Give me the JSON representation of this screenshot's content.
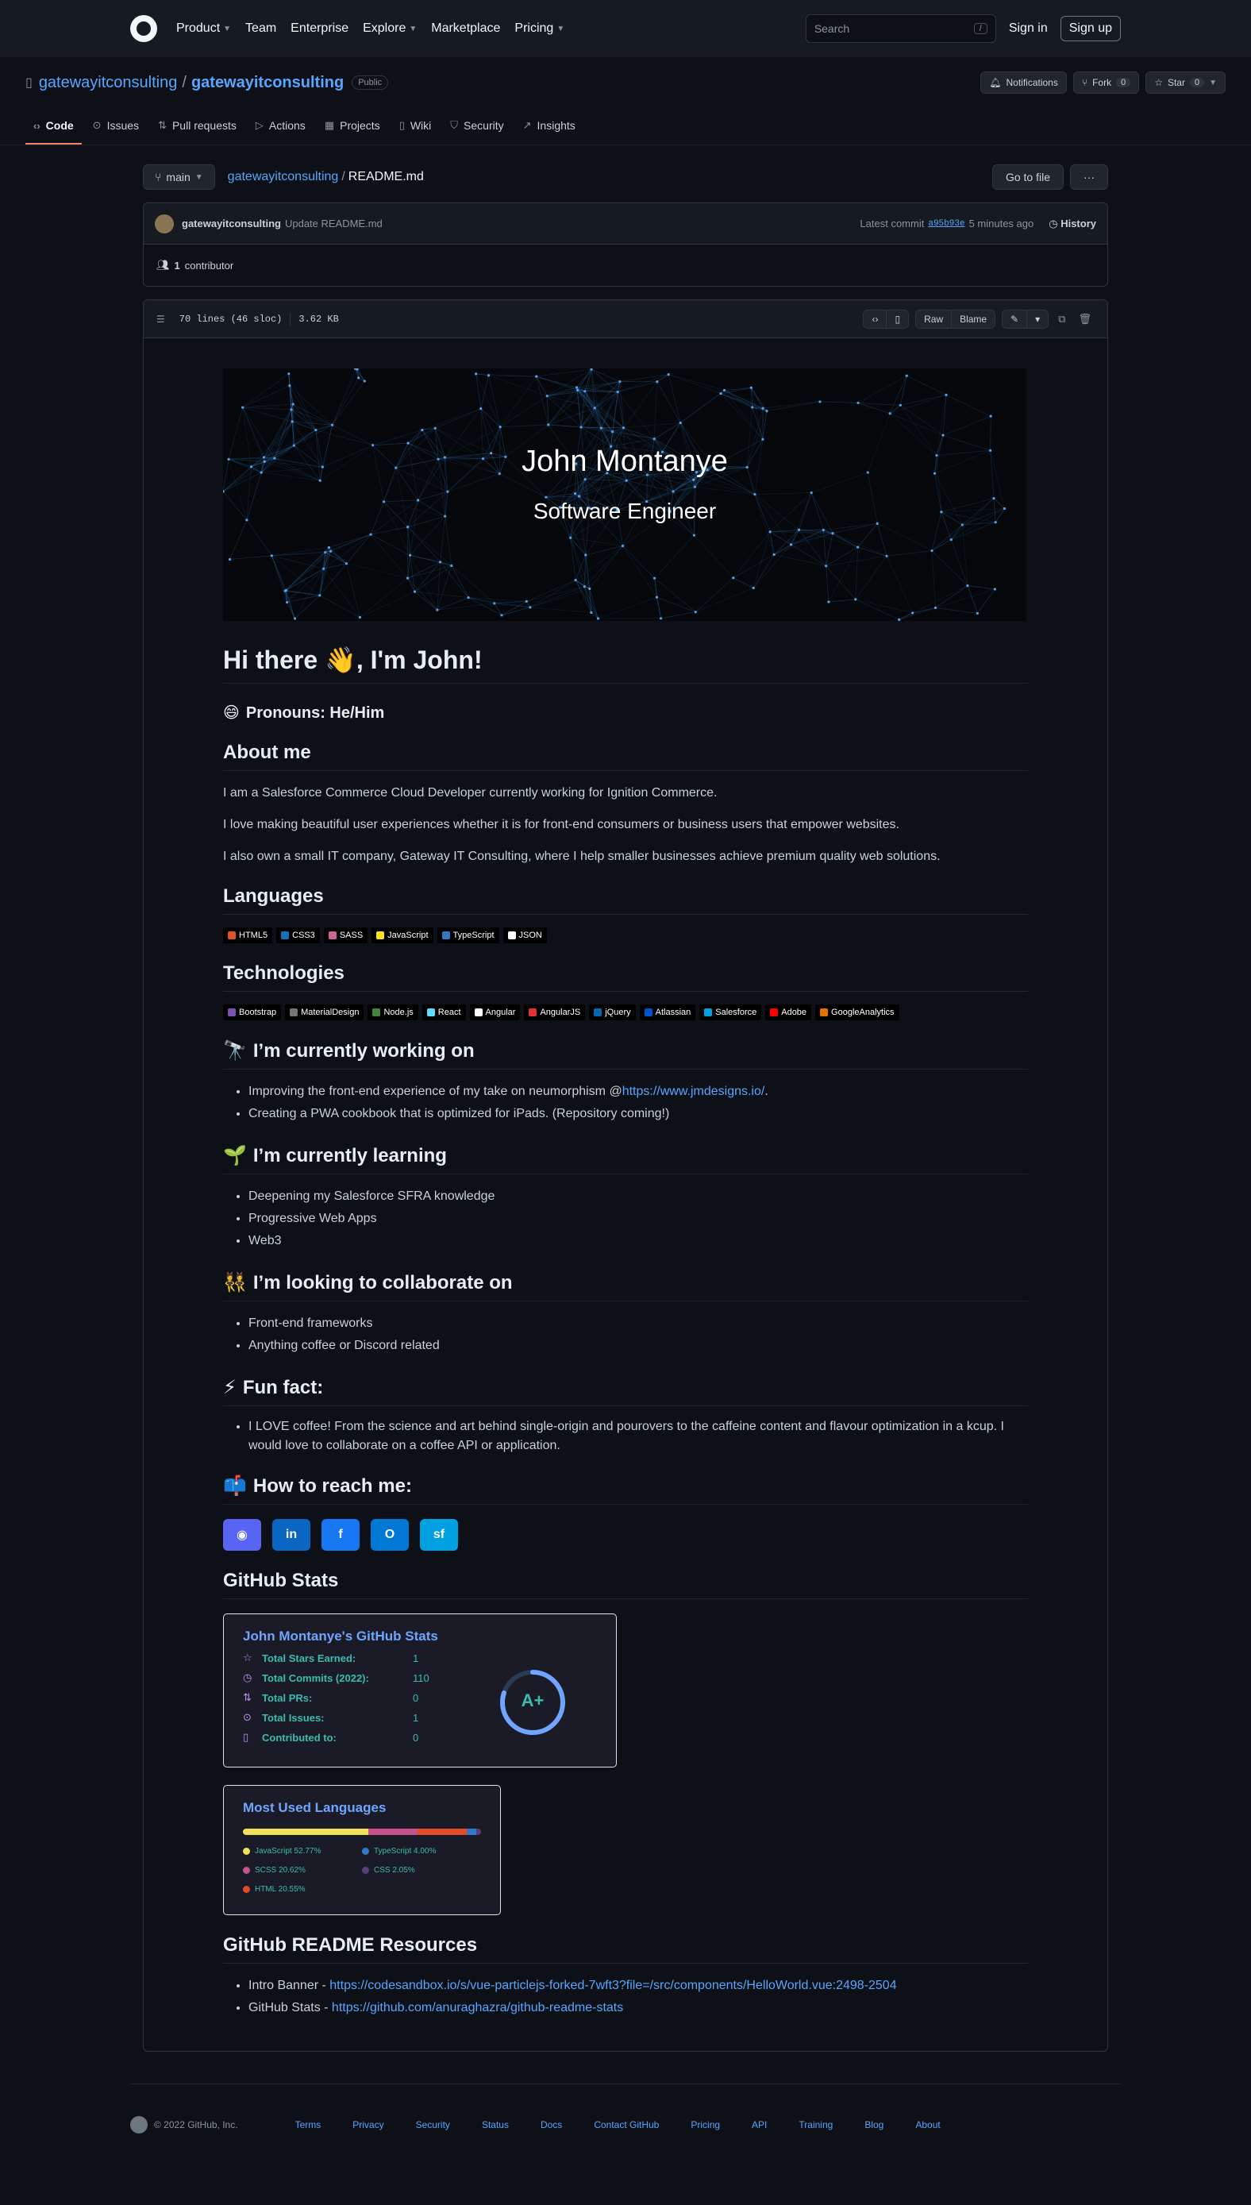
{
  "topnav": {
    "menu": [
      "Product",
      "Team",
      "Enterprise",
      "Explore",
      "Marketplace",
      "Pricing"
    ],
    "menu_dropdown": [
      true,
      false,
      false,
      true,
      false,
      true
    ],
    "search_placeholder": "Search",
    "search_key": "/",
    "signin": "Sign in",
    "signup": "Sign up"
  },
  "repo": {
    "owner": "gatewayitconsulting",
    "name": "gatewayitconsulting",
    "visibility": "Public",
    "notifications": "Notifications",
    "fork_label": "Fork",
    "fork_count": "0",
    "star_label": "Star",
    "star_count": "0"
  },
  "tabs": [
    {
      "label": "Code",
      "icon": "code-icon",
      "glyph": "‹›",
      "active": true
    },
    {
      "label": "Issues",
      "icon": "issue-icon",
      "glyph": "⊙"
    },
    {
      "label": "Pull requests",
      "icon": "pull-request-icon",
      "glyph": "⇅"
    },
    {
      "label": "Actions",
      "icon": "play-icon",
      "glyph": "▷"
    },
    {
      "label": "Projects",
      "icon": "table-icon",
      "glyph": "▦"
    },
    {
      "label": "Wiki",
      "icon": "book-icon",
      "glyph": "▯"
    },
    {
      "label": "Security",
      "icon": "shield-icon",
      "glyph": "⛉"
    },
    {
      "label": "Insights",
      "icon": "graph-icon",
      "glyph": "↗"
    }
  ],
  "filebar": {
    "branch": "main",
    "crumb_repo": "gatewayitconsulting",
    "crumb_file": "README.md",
    "goto": "Go to file",
    "more": "···"
  },
  "commit": {
    "author": "gatewayitconsulting",
    "message": "Update README.md",
    "latest": "Latest commit",
    "sha": "a95b93e",
    "time": "5 minutes ago",
    "history": "History",
    "contributors_count": "1",
    "contributors_label": "contributor"
  },
  "file": {
    "lines": "70 lines (46 sloc)",
    "size": "3.62 KB",
    "raw": "Raw",
    "blame": "Blame"
  },
  "readme": {
    "banner_name": "John Montanye",
    "banner_role": "Software Engineer",
    "greeting_a": "Hi there",
    "greeting_emoji": "👋",
    "greeting_b": ", I'm John!",
    "pronouns_emoji": "😄",
    "pronouns": "Pronouns: He/Him",
    "about_heading": "About me",
    "about": [
      "I am a Salesforce Commerce Cloud Developer currently working for Ignition Commerce.",
      "I love making beautiful user experiences whether it is for front-end consumers or business users that empower websites.",
      "I also own a small IT company, Gateway IT Consulting, where I help smaller businesses achieve premium quality web solutions."
    ],
    "languages_heading": "Languages",
    "languages": [
      {
        "label": "HTML5",
        "color": "#e34f26"
      },
      {
        "label": "CSS3",
        "color": "#1572b6"
      },
      {
        "label": "SASS",
        "color": "#cc6699"
      },
      {
        "label": "JavaScript",
        "color": "#f7df1e"
      },
      {
        "label": "TypeScript",
        "color": "#3178c6"
      },
      {
        "label": "JSON",
        "color": "#ffffff"
      }
    ],
    "tech_heading": "Technologies",
    "technologies": [
      {
        "label": "Bootstrap",
        "color": "#7952b3"
      },
      {
        "label": "MaterialDesign",
        "color": "#757575"
      },
      {
        "label": "Node.js",
        "color": "#43853d"
      },
      {
        "label": "React",
        "color": "#61dafb"
      },
      {
        "label": "Angular",
        "color": "#ffffff"
      },
      {
        "label": "AngularJS",
        "color": "#e23237"
      },
      {
        "label": "jQuery",
        "color": "#0769ad"
      },
      {
        "label": "Atlassian",
        "color": "#0052cc"
      },
      {
        "label": "Salesforce",
        "color": "#00a1e0"
      },
      {
        "label": "Adobe",
        "color": "#ff0000"
      },
      {
        "label": "GoogleAnalytics",
        "color": "#e37400"
      }
    ],
    "working_emoji": "🔭",
    "working_heading": "I’m currently working on",
    "working_1_text": "Improving the front-end experience of my take on neumorphism @",
    "working_1_link": "https://www.jmdesigns.io/",
    "working_1_end": ".",
    "working_2": "Creating a PWA cookbook that is optimized for iPads. (Repository coming!)",
    "learning_emoji": "🌱",
    "learning_heading": "I’m currently learning",
    "learning": [
      "Deepening my Salesforce SFRA knowledge",
      "Progressive Web Apps",
      "Web3"
    ],
    "collab_emoji": "👯",
    "collab_heading": "I’m looking to collaborate on",
    "collab": [
      "Front-end frameworks",
      "Anything coffee or Discord related"
    ],
    "fun_emoji": "⚡",
    "fun_heading": "Fun fact:",
    "fun": "I LOVE coffee! From the science and art behind single-origin and pourovers to the caffeine content and flavour optimization in a kcup. I would love to collaborate on a coffee API or application.",
    "reach_emoji": "📫",
    "reach_heading": "How to reach me:",
    "socials": [
      {
        "name": "discord-icon",
        "glyph": "◉",
        "color": "#5865f2"
      },
      {
        "name": "linkedin-icon",
        "glyph": "in",
        "color": "#0a66c2"
      },
      {
        "name": "facebook-icon",
        "glyph": "f",
        "color": "#1877f2"
      },
      {
        "name": "outlook-icon",
        "glyph": "O",
        "color": "#0078d4"
      },
      {
        "name": "salesforce-icon",
        "glyph": "sf",
        "color": "#00a1e0"
      }
    ],
    "stats_heading": "GitHub Stats",
    "resources_heading": "GitHub README Resources",
    "res_1_label": "Intro Banner - ",
    "res_1_link": "https://codesandbox.io/s/vue-particlejs-forked-7wft3?file=/src/components/HelloWorld.vue:2498-2504",
    "res_2_label": "GitHub Stats - ",
    "res_2_link": "https://github.com/anuraghazra/github-readme-stats"
  },
  "stats_card": {
    "title": "John Montanye's GitHub Stats",
    "rows": [
      {
        "label": "Total Stars Earned:",
        "value": "1",
        "icon": "star-icon",
        "glyph": "☆"
      },
      {
        "label": "Total Commits (2022):",
        "value": "110",
        "icon": "history-icon",
        "glyph": "◷"
      },
      {
        "label": "Total PRs:",
        "value": "0",
        "icon": "pull-request-icon",
        "glyph": "⇅"
      },
      {
        "label": "Total Issues:",
        "value": "1",
        "icon": "issue-icon",
        "glyph": "⊙"
      },
      {
        "label": "Contributed to:",
        "value": "0",
        "icon": "repo-icon",
        "glyph": "▯"
      }
    ],
    "rank": "A+",
    "rank_progress": 0.8
  },
  "lang_card": {
    "title": "Most Used Languages",
    "items": [
      {
        "name": "JavaScript",
        "percent": 52.77,
        "label": "JavaScript 52.77%",
        "color": "#f1e05a"
      },
      {
        "name": "TypeScript",
        "percent": 4.0,
        "label": "TypeScript 4.00%",
        "color": "#3178c6"
      },
      {
        "name": "SCSS",
        "percent": 20.62,
        "label": "SCSS 20.62%",
        "color": "#c6538c"
      },
      {
        "name": "CSS",
        "percent": 2.05,
        "label": "CSS 2.05%",
        "color": "#563d7c"
      },
      {
        "name": "HTML",
        "percent": 20.55,
        "label": "HTML 20.55%",
        "color": "#e34c26"
      }
    ]
  },
  "footer": {
    "copyright": "© 2022 GitHub, Inc.",
    "links": [
      "Terms",
      "Privacy",
      "Security",
      "Status",
      "Docs",
      "Contact GitHub",
      "Pricing",
      "API",
      "Training",
      "Blog",
      "About"
    ]
  }
}
